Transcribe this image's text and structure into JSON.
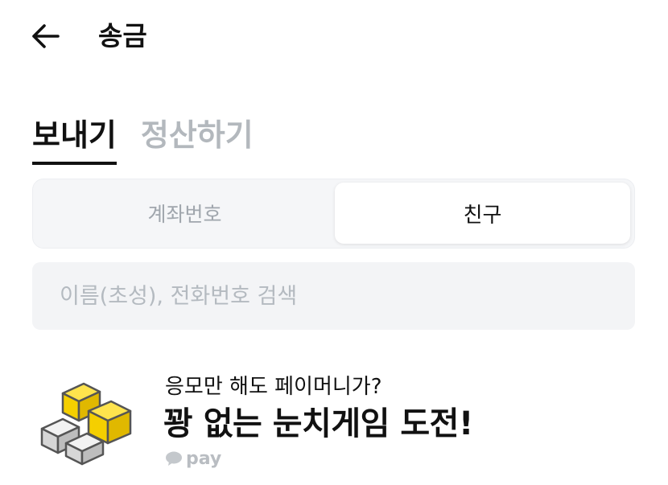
{
  "header": {
    "title": "송금",
    "back_icon": "arrow-left-icon"
  },
  "tabs": [
    {
      "label": "보내기",
      "active": true
    },
    {
      "label": "정산하기",
      "active": false
    }
  ],
  "segment": {
    "options": [
      "계좌번호",
      "친구"
    ],
    "selected": "친구"
  },
  "search": {
    "placeholder": "이름(초성), 전화번호 검색",
    "value": ""
  },
  "promo": {
    "subtitle": "응모만 해도 페이머니가?",
    "title": "꽝 없는 눈치게임 도전!",
    "brand": "pay",
    "brand_icon": "speech-bubble-icon",
    "art_icon": "stacked-blocks-icon"
  },
  "colors": {
    "accent_yellow": "#FFE300",
    "text_primary": "#111111",
    "text_muted": "#B3B8BD",
    "field_bg": "#F3F4F6"
  }
}
